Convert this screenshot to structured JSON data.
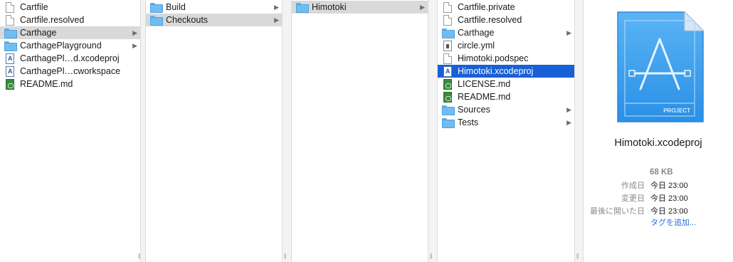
{
  "columns": [
    {
      "items": [
        {
          "label": "Cartfile",
          "icon": "document-icon",
          "chevron": false,
          "state": "none"
        },
        {
          "label": "Cartfile.resolved",
          "icon": "document-icon",
          "chevron": false,
          "state": "none"
        },
        {
          "label": "Carthage",
          "icon": "folder-icon",
          "chevron": true,
          "state": "selected-inactive"
        },
        {
          "label": "CarthagePlayground",
          "icon": "folder-icon",
          "chevron": true,
          "state": "none"
        },
        {
          "label": "CarthagePl…d.xcodeproj",
          "icon": "xcode-project-icon",
          "chevron": false,
          "state": "none"
        },
        {
          "label": "CarthagePl…cworkspace",
          "icon": "xcode-workspace-icon",
          "chevron": false,
          "state": "none"
        },
        {
          "label": "README.md",
          "icon": "markdown-icon",
          "chevron": false,
          "state": "none"
        }
      ]
    },
    {
      "items": [
        {
          "label": "Build",
          "icon": "folder-icon",
          "chevron": true,
          "state": "none"
        },
        {
          "label": "Checkouts",
          "icon": "folder-icon",
          "chevron": true,
          "state": "selected-inactive"
        }
      ]
    },
    {
      "items": [
        {
          "label": "Himotoki",
          "icon": "folder-icon",
          "chevron": true,
          "state": "selected-inactive"
        }
      ]
    },
    {
      "items": [
        {
          "label": "Cartfile.private",
          "icon": "document-icon",
          "chevron": false,
          "state": "none"
        },
        {
          "label": "Cartfile.resolved",
          "icon": "document-icon",
          "chevron": false,
          "state": "none"
        },
        {
          "label": "Carthage",
          "icon": "folder-icon",
          "chevron": true,
          "state": "none"
        },
        {
          "label": "circle.yml",
          "icon": "yml-icon",
          "chevron": false,
          "state": "none"
        },
        {
          "label": "Himotoki.podspec",
          "icon": "document-icon",
          "chevron": false,
          "state": "none"
        },
        {
          "label": "Himotoki.xcodeproj",
          "icon": "xcode-project-icon",
          "chevron": false,
          "state": "selected-active"
        },
        {
          "label": "LICENSE.md",
          "icon": "markdown-icon",
          "chevron": false,
          "state": "none"
        },
        {
          "label": "README.md",
          "icon": "markdown-icon",
          "chevron": false,
          "state": "none"
        },
        {
          "label": "Sources",
          "icon": "folder-icon",
          "chevron": true,
          "state": "none"
        },
        {
          "label": "Tests",
          "icon": "folder-icon",
          "chevron": true,
          "state": "none"
        }
      ]
    }
  ],
  "preview": {
    "icon": "xcode-project-large-icon",
    "icon_label": "PROJECT",
    "filename": "Himotoki.xcodeproj",
    "size": "68 KB",
    "meta": [
      {
        "key": "作成日",
        "value": "今日 23:00"
      },
      {
        "key": "変更日",
        "value": "今日 23:00"
      },
      {
        "key": "最後に開いた日",
        "value": "今日 23:00"
      }
    ],
    "add_tags": "タグを追加..."
  },
  "resize_handle": "||",
  "colors": {
    "selection_active": "#1860d6",
    "selection_inactive": "#d9d9d9",
    "folder": "#71bdf2",
    "link": "#2a6fd8"
  }
}
